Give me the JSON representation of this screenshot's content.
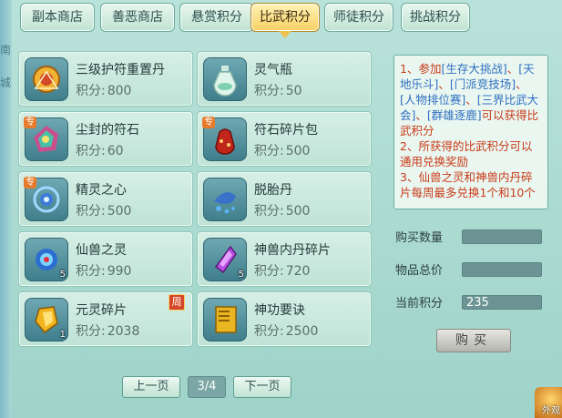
{
  "tabs": [
    {
      "label": "副本商店",
      "active": false
    },
    {
      "label": "善恶商店",
      "active": false
    },
    {
      "label": "悬赏积分",
      "active": false
    },
    {
      "label": "比武积分",
      "active": true
    },
    {
      "label": "师徒积分",
      "active": false
    },
    {
      "label": "挑战积分",
      "active": false
    }
  ],
  "price_label": "积分:",
  "items": [
    {
      "name": "三级护符重置丹",
      "price": "800"
    },
    {
      "name": "灵气瓶",
      "price": "50"
    },
    {
      "name": "尘封的符石",
      "price": "60",
      "badge": "专"
    },
    {
      "name": "符石碎片包",
      "price": "500",
      "badge": "专"
    },
    {
      "name": "精灵之心",
      "price": "500",
      "badge": "专"
    },
    {
      "name": "脱胎丹",
      "price": "500"
    },
    {
      "name": "仙兽之灵",
      "price": "990",
      "count": "5"
    },
    {
      "name": "神兽内丹碎片",
      "price": "720",
      "count": "5"
    },
    {
      "name": "元灵碎片",
      "price": "2038",
      "count": "1",
      "tag": "周"
    },
    {
      "name": "神功要诀",
      "price": "2500"
    }
  ],
  "pager": {
    "prev": "上一页",
    "page": "3/4",
    "next": "下一页"
  },
  "info": {
    "l1a": "1、参加",
    "hl1": "[生存大挑战]",
    "sep1": "、",
    "hl2": "[天地乐斗]",
    "sep2": "、",
    "hl3": "[门派竞技场]",
    "sep3": "、",
    "hl4": "[人物排位赛]",
    "sep4": "、",
    "hl5": "[三界比武大会]",
    "sep5": "、",
    "hl6": "[群雄逐鹿]",
    "l1b": "可以获得比武积分",
    "l2": "2、所获得的比武积分可以通用兑换奖励",
    "l3": "3、仙兽之灵和神兽内丹碎片每周最多兑换1个和10个"
  },
  "form": {
    "qty_label": "购买数量",
    "qty_value": "",
    "total_label": "物品总价",
    "total_value": "",
    "points_label": "当前积分",
    "points_value": "235"
  },
  "buy_label": "购买",
  "left_strip": [
    "南",
    "城"
  ],
  "corner_label": "外观"
}
